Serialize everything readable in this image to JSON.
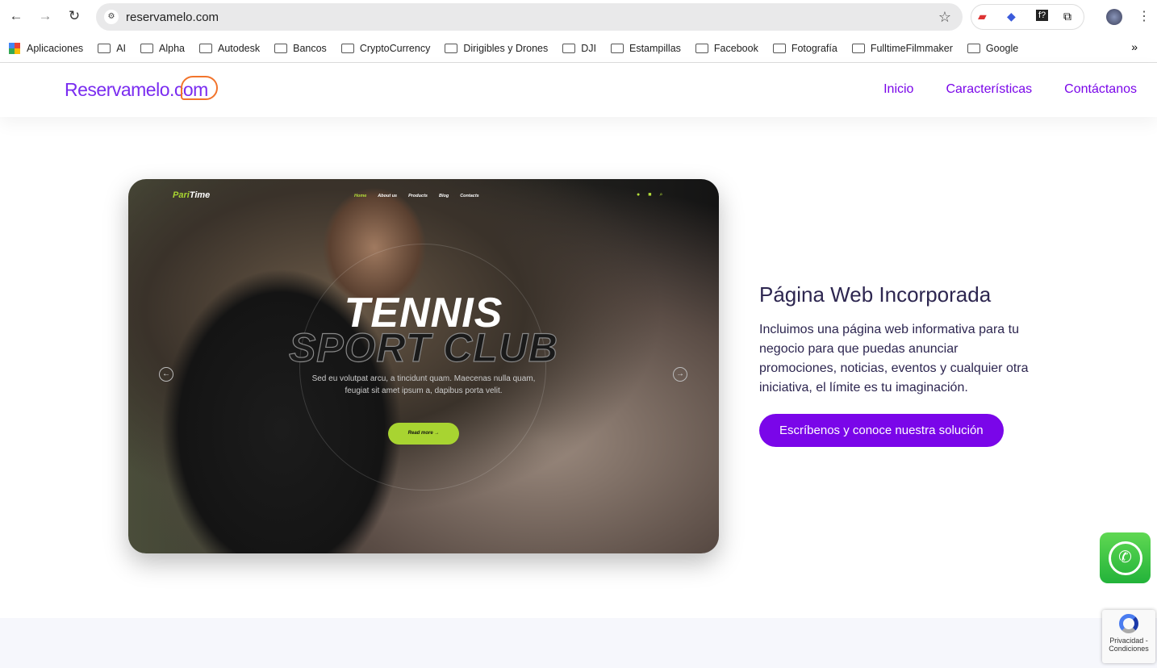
{
  "browser": {
    "url": "reservamelo.com",
    "bookmarks": [
      "Aplicaciones",
      "AI",
      "Alpha",
      "Autodesk",
      "Bancos",
      "CryptoCurrency",
      "Dirigibles y Drones",
      "DJI",
      "Estampillas",
      "Facebook",
      "Fotografía",
      "FulltimeFilmmaker",
      "Google"
    ],
    "more": "»"
  },
  "site": {
    "logo": "Reservamelo.com",
    "nav": [
      "Inicio",
      "Características",
      "Contáctanos"
    ]
  },
  "hero_image": {
    "logo_a": "Pari",
    "logo_b": "Time",
    "nav": [
      "Home",
      "About us",
      "Products",
      "Blog",
      "Contacts"
    ],
    "title1": "TENNIS",
    "title2": "SPORT CLUB",
    "text": "Sed eu volutpat arcu, a tincidunt quam. Maecenas nulla quam, feugiat sit amet ipsum a, dapibus porta velit.",
    "button": "Read more →"
  },
  "feature": {
    "title": "Página Web Incorporada",
    "body": "Incluimos una página web informativa para tu negocio para que puedas anunciar promociones, noticias, eventos y cualquier otra iniciativa, el límite es tu imaginación.",
    "cta": "Escríbenos y conoce nuestra solución"
  },
  "recaptcha": {
    "text": "Privacidad - Condiciones"
  },
  "colors": {
    "brand": "#7a06e9",
    "logo_accent": "#f2742c",
    "hero_accent": "#a8d431",
    "whatsapp": "#25b33a"
  }
}
